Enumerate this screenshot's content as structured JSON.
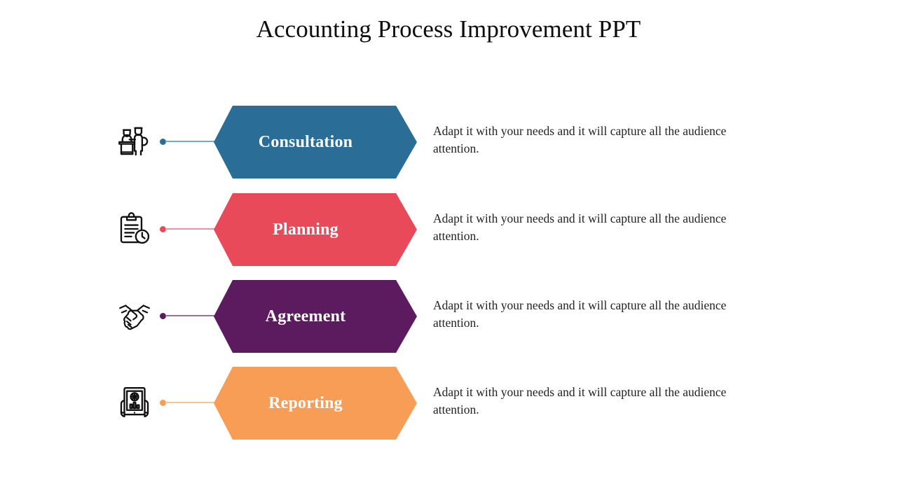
{
  "slide": {
    "title": "Accounting Process Improvement PPT",
    "background_color": "#FFFFFF",
    "title_color": "#0D0D0D"
  },
  "steps": [
    {
      "label": "Consultation",
      "description": "Adapt it with your needs and it will capture all the audience attention.",
      "color": "#2A6D96",
      "icon": "consultation-desk-icon"
    },
    {
      "label": "Planning",
      "description": "Adapt it with your needs and it will capture all the audience attention.",
      "color": "#E84A5A",
      "icon": "clipboard-clock-icon"
    },
    {
      "label": "Agreement",
      "description": "Adapt it with your needs and it will capture all the audience attention.",
      "color": "#5C1B5E",
      "icon": "handshake-icon"
    },
    {
      "label": "Reporting",
      "description": "Adapt it with your needs and it will capture all the audience attention.",
      "color": "#F89D55",
      "icon": "report-tablet-icon"
    }
  ]
}
